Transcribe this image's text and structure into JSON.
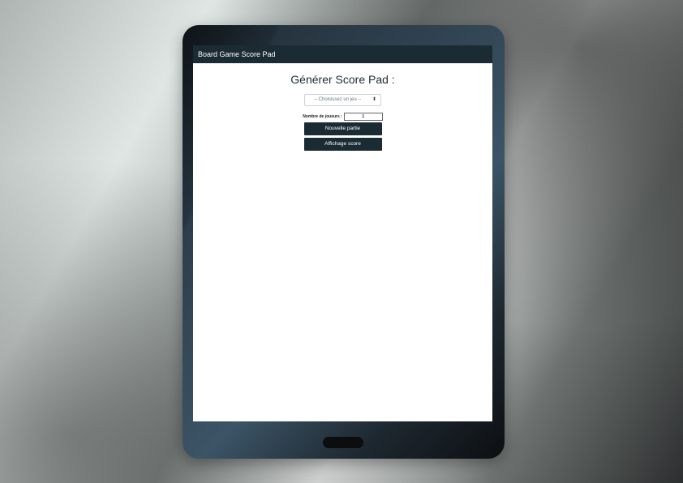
{
  "navbar": {
    "brand": "Board Game Score Pad"
  },
  "main": {
    "title": "Générer Score Pad :",
    "game_select": {
      "selected": "-- Choisissez un jeu --"
    },
    "players": {
      "label": "Nombre de joueurs :",
      "value": "1"
    },
    "buttons": {
      "new_game": "Nouvelle partie",
      "show_score": "Affichage score"
    }
  },
  "colors": {
    "navbar": "#1b2b33",
    "button": "#1b2b33"
  },
  "icons": {
    "select_arrow": "up-down-chevron-icon"
  }
}
